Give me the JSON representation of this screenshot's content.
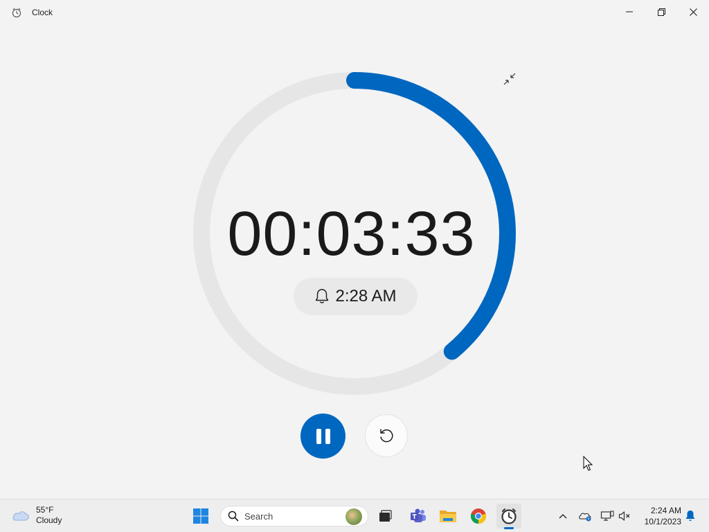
{
  "window": {
    "title": "Clock",
    "icon": "clock-app-icon",
    "controls": [
      "minimize-icon",
      "maximize-icon",
      "close-icon"
    ]
  },
  "timer": {
    "time": "00:03:33",
    "progress_remaining": 0.39,
    "alarm_time": "2:28 AM",
    "accent_color": "#0067c0",
    "track_color": "#e6e6e6",
    "collapse_icon": "collapse-icon",
    "pause_icon": "pause-icon",
    "reset_icon": "reset-icon"
  },
  "taskbar": {
    "weather": {
      "temp": "55°F",
      "condition": "Cloudy",
      "icon": "cloud-icon"
    },
    "search_label": "Search",
    "pinned": [
      "start-icon",
      "search-icon",
      "task-view-icon",
      "teams-icon",
      "file-explorer-icon",
      "chrome-icon",
      "clock-app-icon"
    ],
    "tray": [
      "chevron-up-icon",
      "onedrive-icon",
      "network-icon",
      "volume-muted-icon",
      "notification-bell-icon"
    ],
    "clock": {
      "time": "2:24 AM",
      "date": "10/1/2023"
    }
  }
}
